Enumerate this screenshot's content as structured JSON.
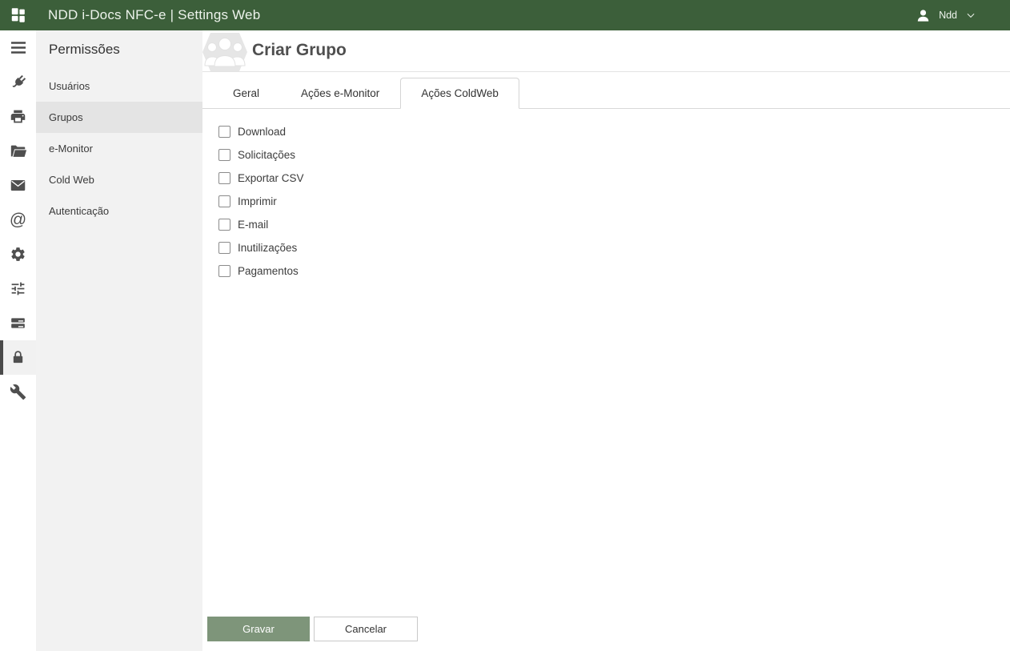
{
  "topbar": {
    "title": "NDD i-Docs NFC-e | Settings Web",
    "user_name": "Ndd"
  },
  "icon_sidebar": {
    "items": [
      {
        "icon": "menu-icon"
      },
      {
        "icon": "plug-icon"
      },
      {
        "icon": "printer-icon"
      },
      {
        "icon": "folder-icon"
      },
      {
        "icon": "mail-icon"
      },
      {
        "icon": "at-sign-icon"
      },
      {
        "icon": "gear-icon"
      },
      {
        "icon": "sliders-icon"
      },
      {
        "icon": "storage-icon"
      },
      {
        "icon": "lock-icon",
        "active": true
      },
      {
        "icon": "wrench-icon"
      }
    ]
  },
  "nav": {
    "title": "Permissões",
    "items": [
      {
        "label": "Usuários",
        "active": false
      },
      {
        "label": "Grupos",
        "active": true
      },
      {
        "label": "e-Monitor",
        "active": false
      },
      {
        "label": "Cold Web",
        "active": false
      },
      {
        "label": "Autenticação",
        "active": false
      }
    ]
  },
  "main": {
    "page_title": "Criar Grupo",
    "tabs": [
      {
        "label": "Geral",
        "active": false
      },
      {
        "label": "Ações e-Monitor",
        "active": false
      },
      {
        "label": "Ações ColdWeb",
        "active": true
      }
    ],
    "checkboxes": [
      {
        "label": "Download",
        "checked": false
      },
      {
        "label": "Solicitações",
        "checked": false
      },
      {
        "label": "Exportar CSV",
        "checked": false
      },
      {
        "label": "Imprimir",
        "checked": false
      },
      {
        "label": "E-mail",
        "checked": false
      },
      {
        "label": "Inutilizações",
        "checked": false
      },
      {
        "label": "Pagamentos",
        "checked": false
      }
    ],
    "actions": {
      "save": "Gravar",
      "cancel": "Cancelar"
    }
  },
  "colors": {
    "topbar_green": "#3c5f3a",
    "save_button_green": "#7e957a",
    "panel_gray": "#f2f2f2",
    "selected_gray": "#e4e4e4"
  }
}
